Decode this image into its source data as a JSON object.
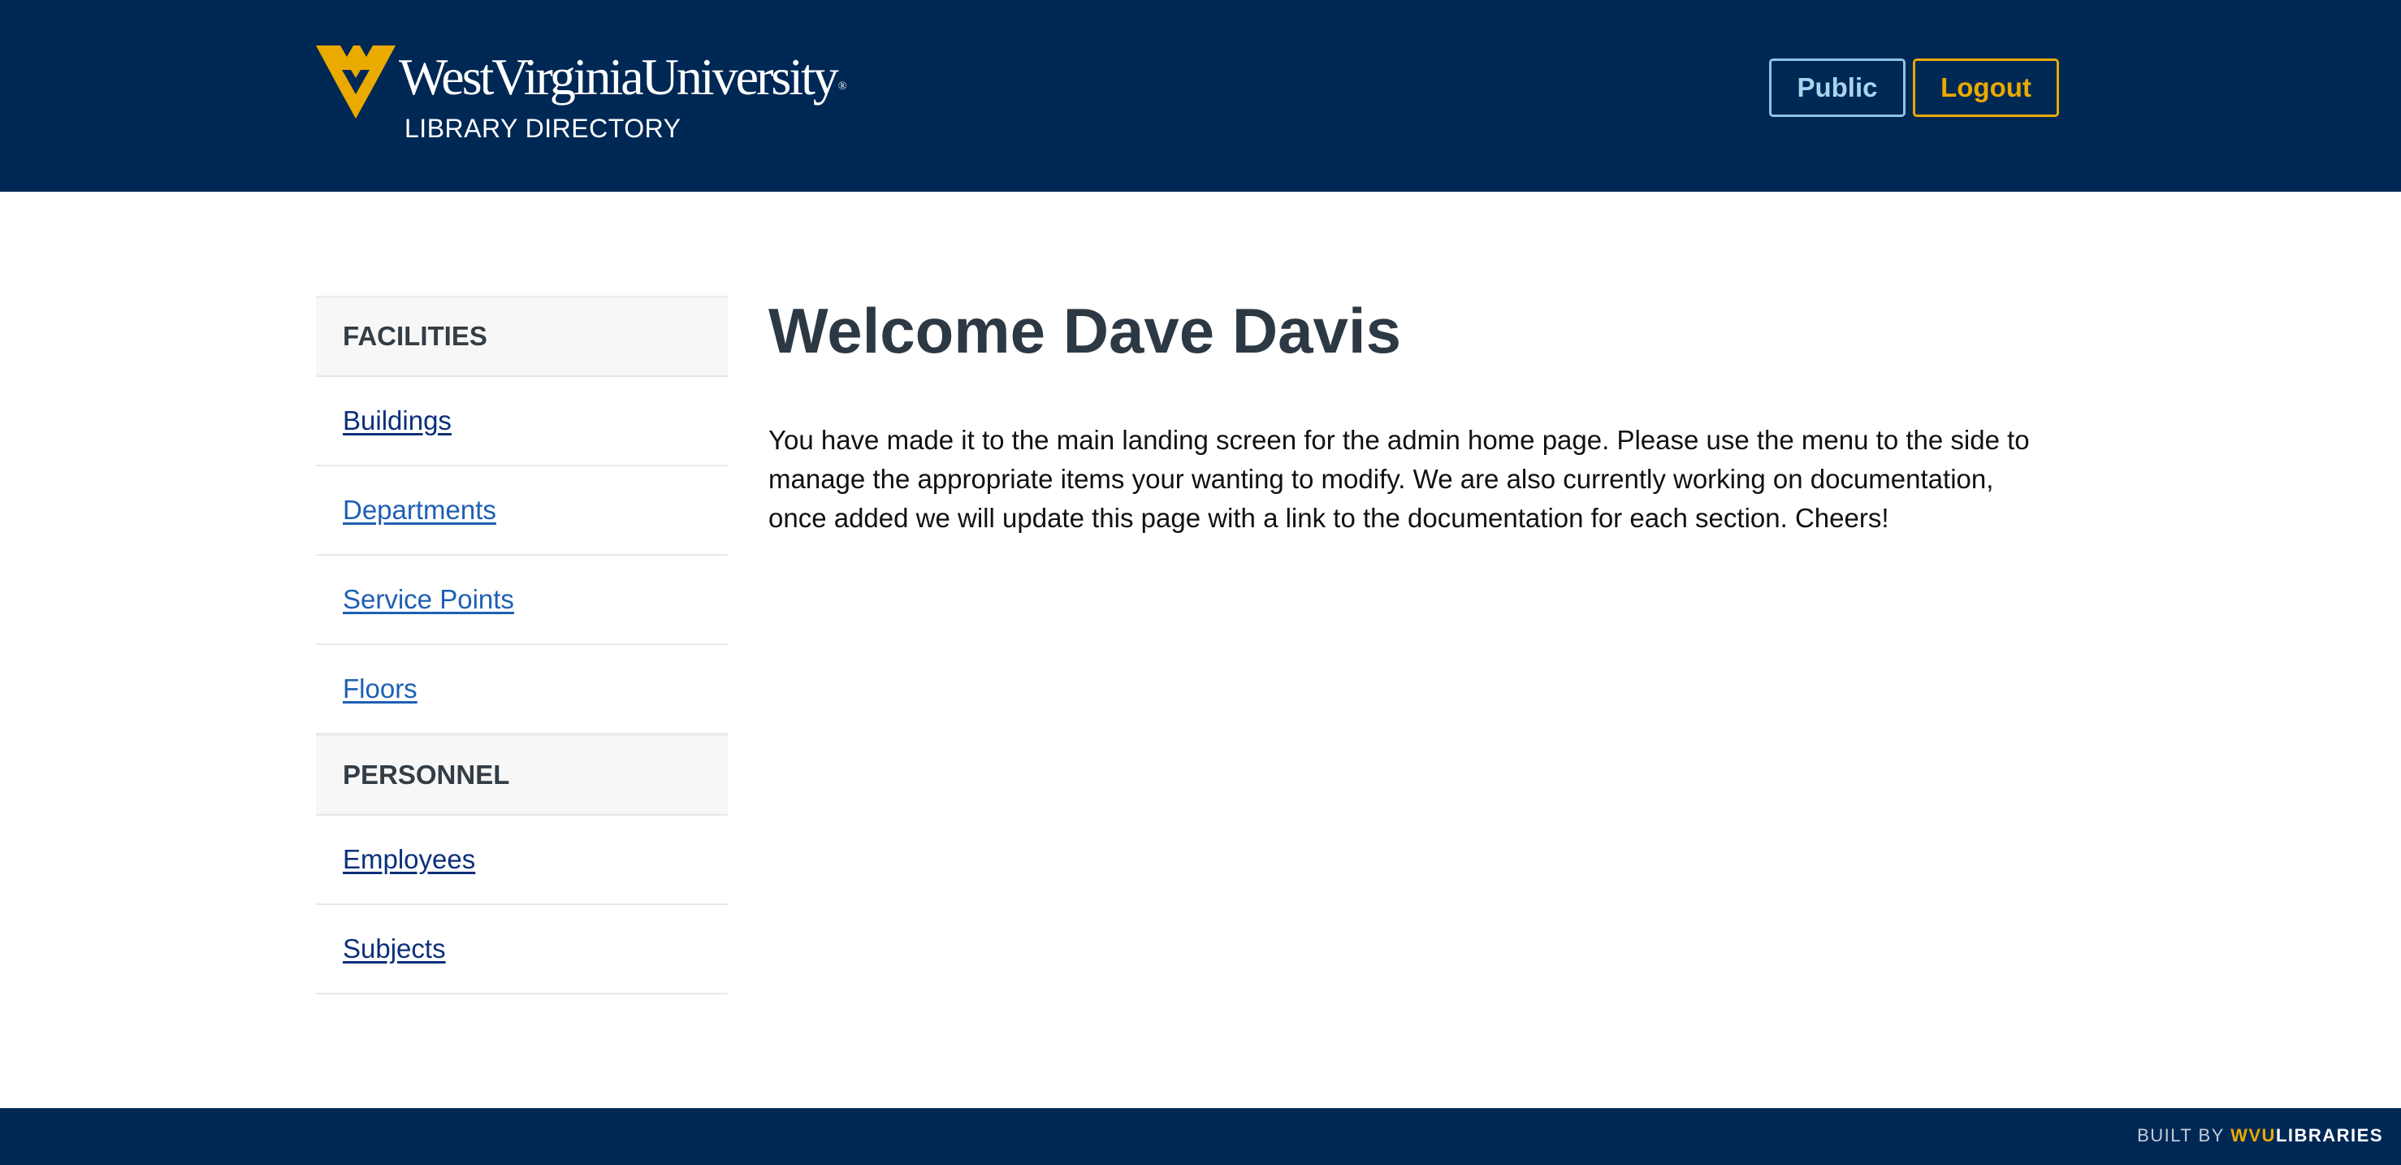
{
  "header": {
    "logo_wordmark": "WestVirginiaUniversity",
    "logo_registered": "®",
    "subtitle": "LIBRARY DIRECTORY",
    "public_button": "Public",
    "logout_button": "Logout"
  },
  "sidebar": {
    "sections": [
      {
        "heading": "FACILITIES",
        "links": [
          "Buildings",
          "Departments",
          "Service Points",
          "Floors"
        ]
      },
      {
        "heading": "PERSONNEL",
        "links": [
          "Employees",
          "Subjects"
        ]
      }
    ]
  },
  "main": {
    "title": "Welcome Dave Davis",
    "body": "You have made it to the main landing screen for the admin home page. Please use the menu to the side to manage the appropriate items your wanting to modify. We are also currently working on documentation, once added we will update this page with a link to the documentation for each section. Cheers!"
  },
  "footer": {
    "built_by_prefix": "BUILT BY ",
    "built_by_wvu": "WVU",
    "built_by_libraries": "LIBRARIES"
  },
  "colors": {
    "navy": "#002855",
    "gold": "#eaaa00",
    "public_border": "#8ec5e6",
    "link_blue": "#1f5fb4",
    "link_visited": "#0b2f7a",
    "heading_text": "#2c3944"
  },
  "icons": {
    "logo": "flying-wv-logo"
  }
}
